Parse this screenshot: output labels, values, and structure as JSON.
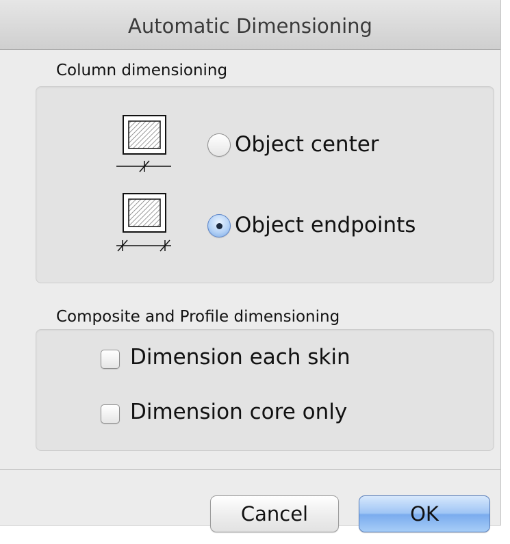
{
  "dialog": {
    "title": "Automatic Dimensioning"
  },
  "column_dimensioning": {
    "label": "Column dimensioning",
    "options": [
      {
        "label": "Object center",
        "selected": false,
        "icon": "column-center-dimension-icon"
      },
      {
        "label": "Object endpoints",
        "selected": true,
        "icon": "column-endpoints-dimension-icon"
      }
    ]
  },
  "composite_dimensioning": {
    "label": "Composite and Profile dimensioning",
    "options": [
      {
        "label": "Dimension each skin",
        "checked": false
      },
      {
        "label": "Dimension core only",
        "checked": false
      }
    ]
  },
  "buttons": {
    "cancel": "Cancel",
    "ok": "OK"
  },
  "colors": {
    "dialog_bg": "#ececec",
    "group_bg": "#e3e3e3",
    "ok_button_blue": "#8fbaf2",
    "selected_radio_blue": "#b6d3f6"
  }
}
